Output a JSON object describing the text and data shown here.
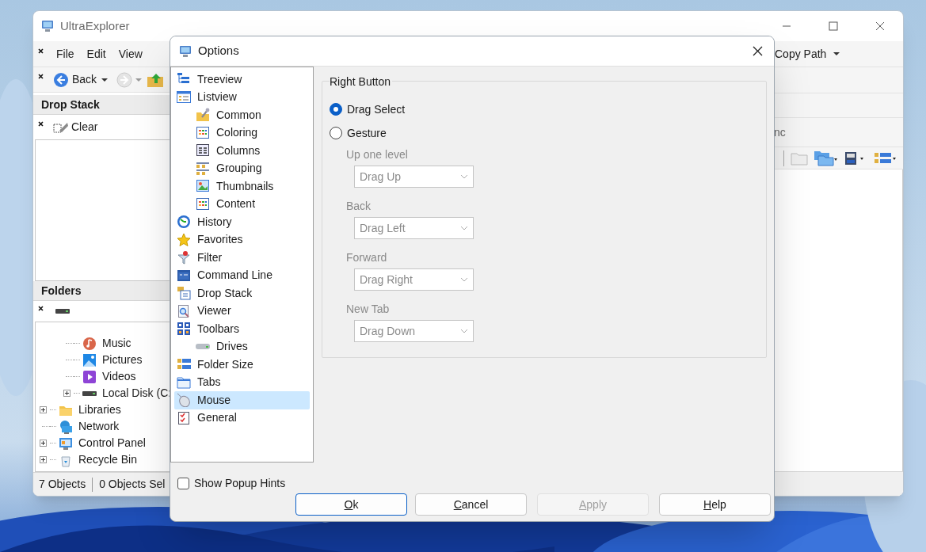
{
  "main_window": {
    "title": "UltraExplorer",
    "menu": [
      "File",
      "Edit",
      "View"
    ],
    "back_label": "Back",
    "right_menu": "Copy Path",
    "partial_label": "nc",
    "drop_stack": {
      "title": "Drop Stack",
      "clear_label": "Clear"
    },
    "folders": {
      "title": "Folders",
      "tree": [
        {
          "children": [
            {
              "label": "Music"
            },
            {
              "label": "Pictures"
            },
            {
              "label": "Videos"
            },
            {
              "label": "Local Disk (C:",
              "expanded": false
            }
          ]
        },
        {
          "label": "Libraries",
          "expanded": false
        },
        {
          "label": "Network"
        },
        {
          "label": "Control Panel",
          "expanded": false
        },
        {
          "label": "Recycle Bin",
          "expanded": false
        }
      ]
    },
    "status_bar": [
      "7 Objects",
      "0 Objects Sel"
    ]
  },
  "dialog": {
    "title": "Options",
    "nav": [
      {
        "label": "Treeview",
        "selected": false
      },
      {
        "label": "Listview",
        "selected": false,
        "children": [
          {
            "label": "Common",
            "selected": false
          },
          {
            "label": "Coloring",
            "selected": false
          },
          {
            "label": "Columns",
            "selected": false
          },
          {
            "label": "Grouping",
            "selected": false
          },
          {
            "label": "Thumbnails",
            "selected": false
          },
          {
            "label": "Content",
            "selected": false
          }
        ]
      },
      {
        "label": "History",
        "selected": false
      },
      {
        "label": "Favorites",
        "selected": false
      },
      {
        "label": "Filter",
        "selected": false
      },
      {
        "label": "Command Line",
        "selected": false
      },
      {
        "label": "Drop Stack",
        "selected": false
      },
      {
        "label": "Viewer",
        "selected": false
      },
      {
        "label": "Toolbars",
        "selected": false,
        "children": [
          {
            "label": "Drives",
            "selected": false
          }
        ]
      },
      {
        "label": "Folder Size",
        "selected": false
      },
      {
        "label": "Tabs",
        "selected": false
      },
      {
        "label": "Mouse",
        "selected": true
      },
      {
        "label": "General",
        "selected": false
      }
    ],
    "group": {
      "title": "Right Button",
      "options": [
        {
          "label": "Drag Select",
          "selected": true
        },
        {
          "label": "Gesture",
          "selected": false
        }
      ],
      "gestures": [
        {
          "label": "Up one level",
          "value": "Drag Up",
          "disabled": true
        },
        {
          "label": "Back",
          "value": "Drag Left",
          "disabled": true
        },
        {
          "label": "Forward",
          "value": "Drag Right",
          "disabled": true
        },
        {
          "label": "New Tab",
          "value": "Drag Down",
          "disabled": true
        }
      ]
    },
    "show_popup_hints": {
      "label": "Show Popup Hints",
      "checked": false
    },
    "buttons": [
      {
        "label": "Ok",
        "default": true,
        "disabled": false
      },
      {
        "label": "Cancel",
        "default": false,
        "disabled": false
      },
      {
        "label": "Apply",
        "default": false,
        "disabled": true
      },
      {
        "label": "Help",
        "default": false,
        "disabled": false
      }
    ]
  }
}
